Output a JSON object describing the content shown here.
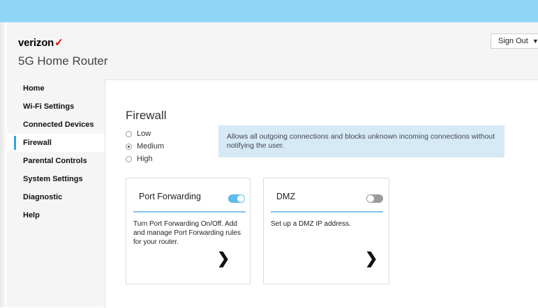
{
  "header": {
    "brand": "verizon",
    "brand_mark": "✓",
    "product": "5G Home Router",
    "signout_label": "Sign Out",
    "accent_color": "#8fd6f6"
  },
  "sidebar": {
    "items": [
      {
        "label": "Home"
      },
      {
        "label": "Wi-Fi Settings"
      },
      {
        "label": "Connected Devices"
      },
      {
        "label": "Firewall",
        "active": true
      },
      {
        "label": "Parental Controls"
      },
      {
        "label": "System Settings"
      },
      {
        "label": "Diagnostic"
      },
      {
        "label": "Help"
      }
    ]
  },
  "main": {
    "title": "Firewall",
    "firewall_levels": [
      {
        "label": "Low",
        "checked": false
      },
      {
        "label": "Medium",
        "checked": true
      },
      {
        "label": "High",
        "checked": false
      }
    ],
    "info_text": "Allows all outgoing connections and blocks unknown incoming connections without notifying the user.",
    "cards": [
      {
        "title": "Port Forwarding",
        "enabled": true,
        "description": "Turn Port Forwarding On/Off. Add and manage Port Forwarding rules for your router."
      },
      {
        "title": "DMZ",
        "enabled": false,
        "description": "Set up a DMZ IP address."
      }
    ]
  }
}
